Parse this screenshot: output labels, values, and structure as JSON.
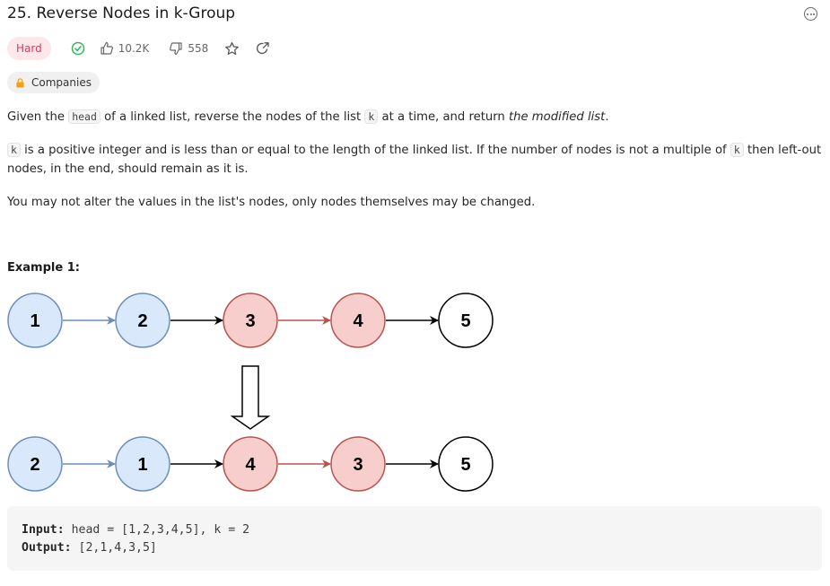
{
  "problem": {
    "title": "25. Reverse Nodes in k-Group",
    "difficulty": "Hard",
    "likes": "10.2K",
    "dislikes": "558",
    "companies_label": "Companies"
  },
  "description": {
    "p1_a": "Given the ",
    "p1_code1": "head",
    "p1_b": " of a linked list, reverse the nodes of the list ",
    "p1_code2": "k",
    "p1_c": " at a time, and return ",
    "p1_em": "the modified list",
    "p1_d": ".",
    "p2_code1": "k",
    "p2_a": " is a positive integer and is less than or equal to the length of the linked list. If the number of nodes is not a multiple of ",
    "p2_code2": "k",
    "p2_b": " then left-out nodes, in the end, should remain as it is.",
    "p3": "You may not alter the values in the list's nodes, only nodes themselves may be changed."
  },
  "example": {
    "title": "Example 1:",
    "top_row": [
      "1",
      "2",
      "3",
      "4",
      "5"
    ],
    "bottom_row": [
      "2",
      "1",
      "4",
      "3",
      "5"
    ],
    "input_label": "Input:",
    "input_value": "head = [1,2,3,4,5], k = 2",
    "output_label": "Output:",
    "output_value": "[2,1,4,3,5]"
  },
  "colors": {
    "hard_bg": "#fde7ea",
    "hard_text": "#e0385a",
    "solved_green": "#2cbb5d",
    "blue_fill": "#dae8fc",
    "blue_stroke": "#6c8ebf",
    "red_fill": "#f8cecc",
    "red_stroke": "#b85450"
  },
  "icons": [
    "check-circle-icon",
    "thumbs-up-icon",
    "thumbs-down-icon",
    "star-icon",
    "share-icon",
    "lock-icon",
    "more-icon",
    "down-arrow-icon"
  ]
}
